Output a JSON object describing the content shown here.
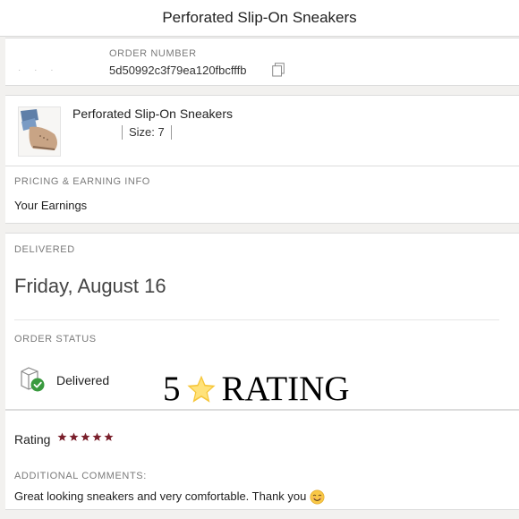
{
  "header": {
    "title": "Perforated Slip-On Sneakers"
  },
  "order": {
    "label": "ORDER NUMBER",
    "number": "5d50992c3f79ea120fbcfffb",
    "ghost_dots": "· · ·"
  },
  "item": {
    "name": "Perforated Slip-On Sneakers",
    "size": "Size: 7"
  },
  "pricing": {
    "label": "PRICING & EARNING INFO",
    "earnings_label": "Your Earnings"
  },
  "delivery": {
    "label": "DELIVERED",
    "date": "Friday, August 16"
  },
  "status": {
    "label": "ORDER STATUS",
    "value": "Delivered"
  },
  "overlay": {
    "left_text": "5",
    "right_text": "RATING",
    "star_color": "#f6c63a"
  },
  "rating": {
    "label": "Rating",
    "stars": 5,
    "max_stars": 5,
    "star_color": "#7a1f2b"
  },
  "comments": {
    "label": "ADDITIONAL COMMENTS:",
    "text": "Great looking sneakers and very comfortable. Thank you"
  },
  "icons": {
    "copy": "copy-icon",
    "status": "delivered-status-icon",
    "emoji": "smiling-face-emoji-icon"
  }
}
